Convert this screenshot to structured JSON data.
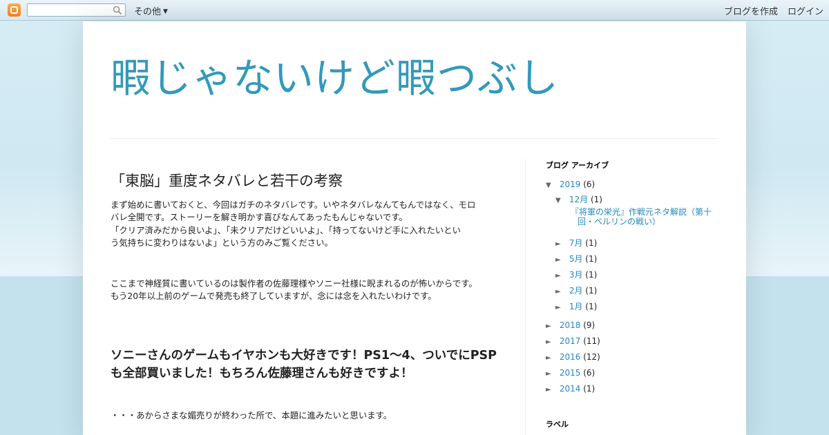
{
  "navbar": {
    "more_label": "その他",
    "create_blog": "ブログを作成",
    "login": "ログイン"
  },
  "blog": {
    "title": "暇じゃないけど暇つぶし"
  },
  "post": {
    "title": "「東脳」重度ネタバレと若干の考察",
    "paragraph1_lines": [
      "まず始めに書いておくと、今回はガチのネタバレです。いやネタバレなんてもんではなく、モロ",
      "バレ全開です。ストーリーを解き明かす喜びなんてあったもんじゃないです。",
      "「クリア済みだから良いよ」、「未クリアだけどいいよ」、「持ってないけど手に入れたいとい",
      "う気持ちに変わりはないよ」という方のみご覧ください。"
    ],
    "paragraph2_lines": [
      "ここまで神経質に書いているのは製作者の佐藤理様やソニー社様に睨まれるのが怖いからです。",
      "もう20年以上前のゲームで発売も終了していますが、念には念を入れたいわけです。"
    ],
    "heading_lines": [
      "ソニーさんのゲームもイヤホンも大好きです！PS1～4、ついでにPSP",
      "も全部買いました！もちろん佐藤理さんも好きですよ！"
    ],
    "paragraph3": "・・・あからさまな媚売りが終わった所で、本題に進みたいと思います。"
  },
  "sidebar": {
    "archive_title": "ブログ アーカイブ",
    "labels_title": "ラベル",
    "archive": [
      {
        "toggle": "▼",
        "label": "2019",
        "count": "(6)"
      },
      {
        "toggle": "▼",
        "label": "12月",
        "count": "(1)"
      },
      {
        "post_title_lines": [
          "『将軍の栄光』作戦元ネタ解説（第十",
          "回・ベルリンの戦い）"
        ]
      },
      {
        "toggle": "►",
        "label": "7月",
        "count": "(1)"
      },
      {
        "toggle": "►",
        "label": "5月",
        "count": "(1)"
      },
      {
        "toggle": "►",
        "label": "3月",
        "count": "(1)"
      },
      {
        "toggle": "►",
        "label": "2月",
        "count": "(1)"
      },
      {
        "toggle": "►",
        "label": "1月",
        "count": "(1)"
      },
      {
        "toggle": "►",
        "label": "2018",
        "count": "(9)"
      },
      {
        "toggle": "►",
        "label": "2017",
        "count": "(11)"
      },
      {
        "toggle": "►",
        "label": "2016",
        "count": "(12)"
      },
      {
        "toggle": "►",
        "label": "2015",
        "count": "(6)"
      },
      {
        "toggle": "►",
        "label": "2014",
        "count": "(1)"
      }
    ]
  },
  "colors": {
    "title": "#3399bb",
    "link": "#2288bb",
    "background": "#c6e3ef"
  }
}
